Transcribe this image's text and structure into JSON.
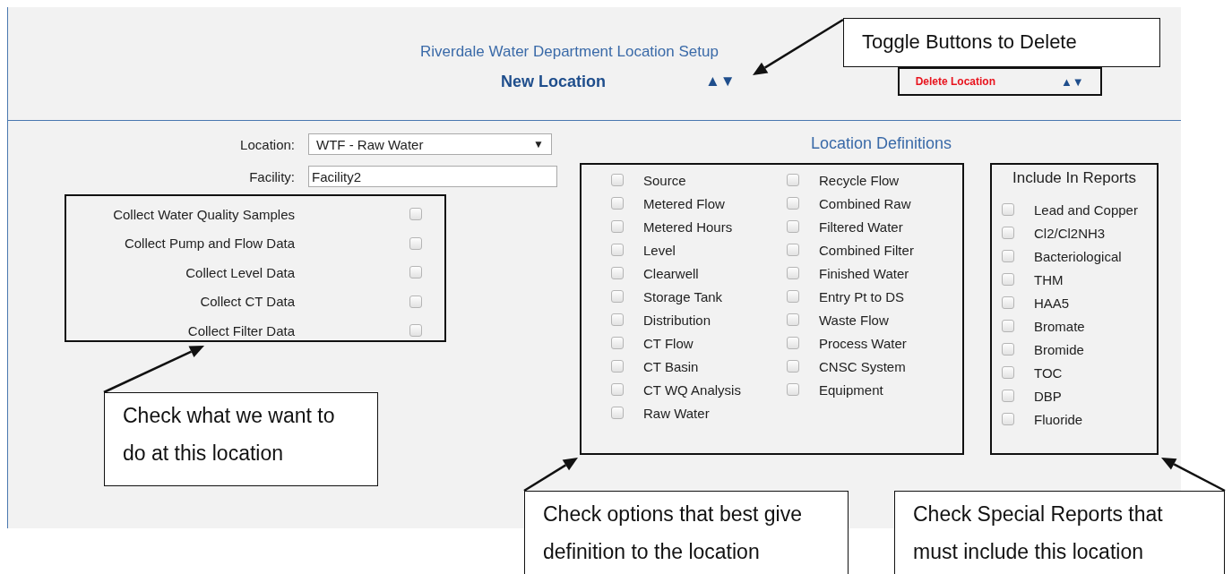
{
  "header": {
    "title": "Riverdale Water Department Location Setup",
    "subtitle": "New Location",
    "toggle_arrows": "▲▼",
    "delete_control": {
      "label": "Delete Location",
      "arrows": "▲▼"
    }
  },
  "location": {
    "label": "Location:",
    "value": "WTF - Raw Water",
    "caret": "▼"
  },
  "facility": {
    "label": "Facility:",
    "value": "Facility2"
  },
  "collect_options": [
    {
      "label": "Collect Water Quality Samples",
      "checked": false
    },
    {
      "label": "Collect Pump and Flow Data",
      "checked": false
    },
    {
      "label": "Collect Level Data",
      "checked": false
    },
    {
      "label": "Collect CT Data",
      "checked": false
    },
    {
      "label": "Collect Filter Data",
      "checked": false
    }
  ],
  "location_definitions": {
    "title": "Location Definitions",
    "columns": [
      [
        {
          "label": "Source",
          "checked": false
        },
        {
          "label": "Metered Flow",
          "checked": false
        },
        {
          "label": "Metered Hours",
          "checked": false
        },
        {
          "label": "Level",
          "checked": false
        },
        {
          "label": "Clearwell",
          "checked": false
        },
        {
          "label": "Storage Tank",
          "checked": false
        },
        {
          "label": "Distribution",
          "checked": false
        },
        {
          "label": "CT Flow",
          "checked": false
        },
        {
          "label": "CT Basin",
          "checked": false
        },
        {
          "label": "CT WQ Analysis",
          "checked": false
        },
        {
          "label": "Raw Water",
          "checked": false
        }
      ],
      [
        {
          "label": "Recycle Flow",
          "checked": false
        },
        {
          "label": "Combined Raw",
          "checked": false
        },
        {
          "label": "Filtered Water",
          "checked": false
        },
        {
          "label": "Combined Filter",
          "checked": false
        },
        {
          "label": "Finished Water",
          "checked": false
        },
        {
          "label": "Entry Pt to DS",
          "checked": false
        },
        {
          "label": "Waste Flow",
          "checked": false
        },
        {
          "label": "Process Water",
          "checked": false
        },
        {
          "label": "CNSC System",
          "checked": false
        },
        {
          "label": "Equipment",
          "checked": false
        }
      ]
    ]
  },
  "reports": {
    "title": "Include In Reports",
    "items": [
      {
        "label": "Lead and Copper",
        "checked": false
      },
      {
        "label": "Cl2/Cl2NH3",
        "checked": false
      },
      {
        "label": "Bacteriological",
        "checked": false
      },
      {
        "label": "THM",
        "checked": false
      },
      {
        "label": "HAA5",
        "checked": false
      },
      {
        "label": "Bromate",
        "checked": false
      },
      {
        "label": "Bromide",
        "checked": false
      },
      {
        "label": "TOC",
        "checked": false
      },
      {
        "label": "DBP",
        "checked": false
      },
      {
        "label": "Fluoride",
        "checked": false
      }
    ]
  },
  "callouts": [
    {
      "text": "Toggle Buttons to Delete"
    },
    {
      "text": "Check what we want to do at this location"
    },
    {
      "text": "Check options that best give definition to the location"
    },
    {
      "text": "Check Special Reports that must include this location"
    }
  ]
}
